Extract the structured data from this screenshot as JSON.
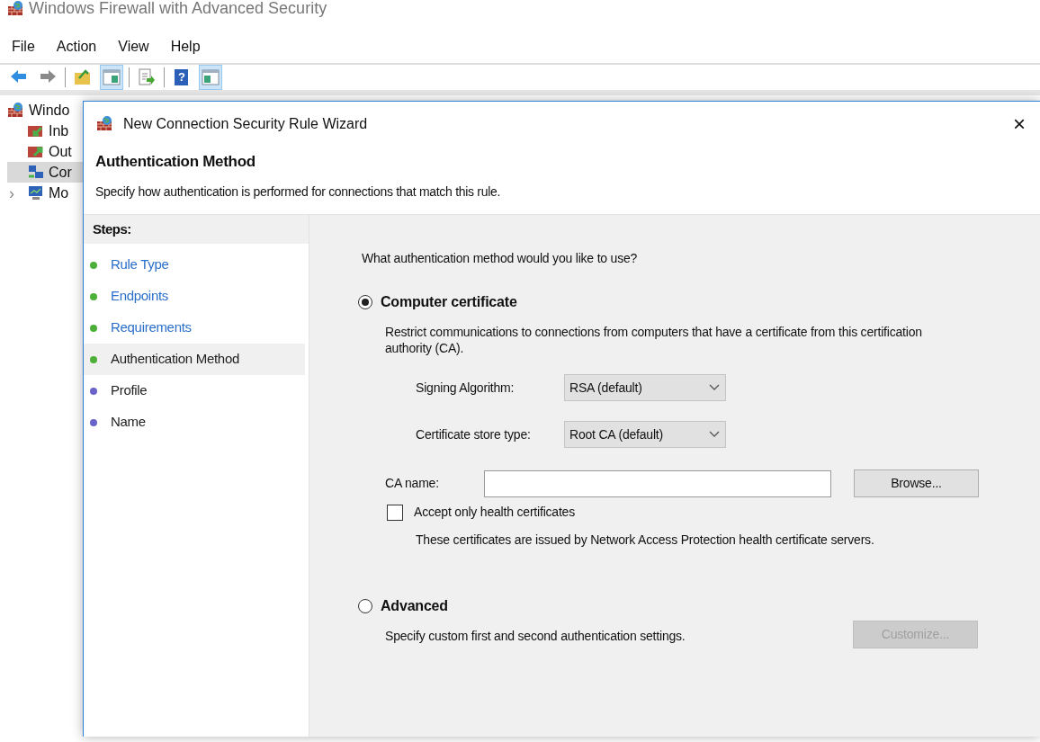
{
  "window": {
    "title": "Windows Firewall with Advanced Security"
  },
  "menu": [
    "File",
    "Action",
    "View",
    "Help"
  ],
  "toolbar": [
    {
      "kind": "back",
      "selected": false
    },
    {
      "kind": "forward",
      "selected": false
    },
    {
      "kind": "sep"
    },
    {
      "kind": "up",
      "selected": false
    },
    {
      "kind": "pane",
      "selected": true
    },
    {
      "kind": "sep"
    },
    {
      "kind": "export",
      "selected": false
    },
    {
      "kind": "sep"
    },
    {
      "kind": "help",
      "selected": false,
      "glyph": "?"
    },
    {
      "kind": "pane2",
      "selected": true
    }
  ],
  "tree": [
    {
      "label": "Windo",
      "kind": "root",
      "selected": false,
      "children": [
        {
          "label": "Inb",
          "kind": "inbound",
          "selected": false
        },
        {
          "label": "Out",
          "kind": "outbound",
          "selected": false
        },
        {
          "label": "Cor",
          "kind": "connection",
          "selected": true
        },
        {
          "label": "Mo",
          "kind": "monitor",
          "selected": false,
          "expander": "›"
        }
      ]
    }
  ],
  "dialog": {
    "title": "New Connection Security Rule Wizard",
    "close": "×",
    "heading": "Authentication Method",
    "subtitle": "Specify how authentication is performed for connections that match this rule.",
    "steps_title": "Steps:",
    "steps": [
      {
        "label": "Rule Type",
        "link": true,
        "selected": false,
        "color": "#4caf3a"
      },
      {
        "label": "Endpoints",
        "link": true,
        "selected": false,
        "color": "#4caf3a"
      },
      {
        "label": "Requirements",
        "link": true,
        "selected": false,
        "color": "#4caf3a"
      },
      {
        "label": "Authentication Method",
        "link": false,
        "selected": true,
        "color": "#4caf3a"
      },
      {
        "label": "Profile",
        "link": false,
        "selected": false,
        "color": "#6a63c9"
      },
      {
        "label": "Name",
        "link": false,
        "selected": false,
        "color": "#6a63c9"
      }
    ],
    "question": "What authentication method would you like to use?",
    "options": [
      {
        "label": "Computer certificate",
        "selected": true,
        "description": "Restrict communications to connections from computers that have a certificate from this certification authority (CA)."
      },
      {
        "label": "Advanced",
        "selected": false,
        "description": "Specify custom first and second authentication settings."
      }
    ],
    "dropdowns": [
      {
        "label": "Signing Algorithm:",
        "value": "RSA (default)"
      },
      {
        "label": "Certificate store type:",
        "value": "Root CA (default)"
      }
    ],
    "ca_name": {
      "label": "CA name:"
    },
    "browse": {
      "label": "Browse...",
      "disabled": false
    },
    "health": {
      "label": "Accept only health certificates",
      "checked": false,
      "note": "These certificates are issued by Network Access Protection health certificate servers."
    },
    "customize": {
      "label": "Customize...",
      "disabled": true
    }
  }
}
